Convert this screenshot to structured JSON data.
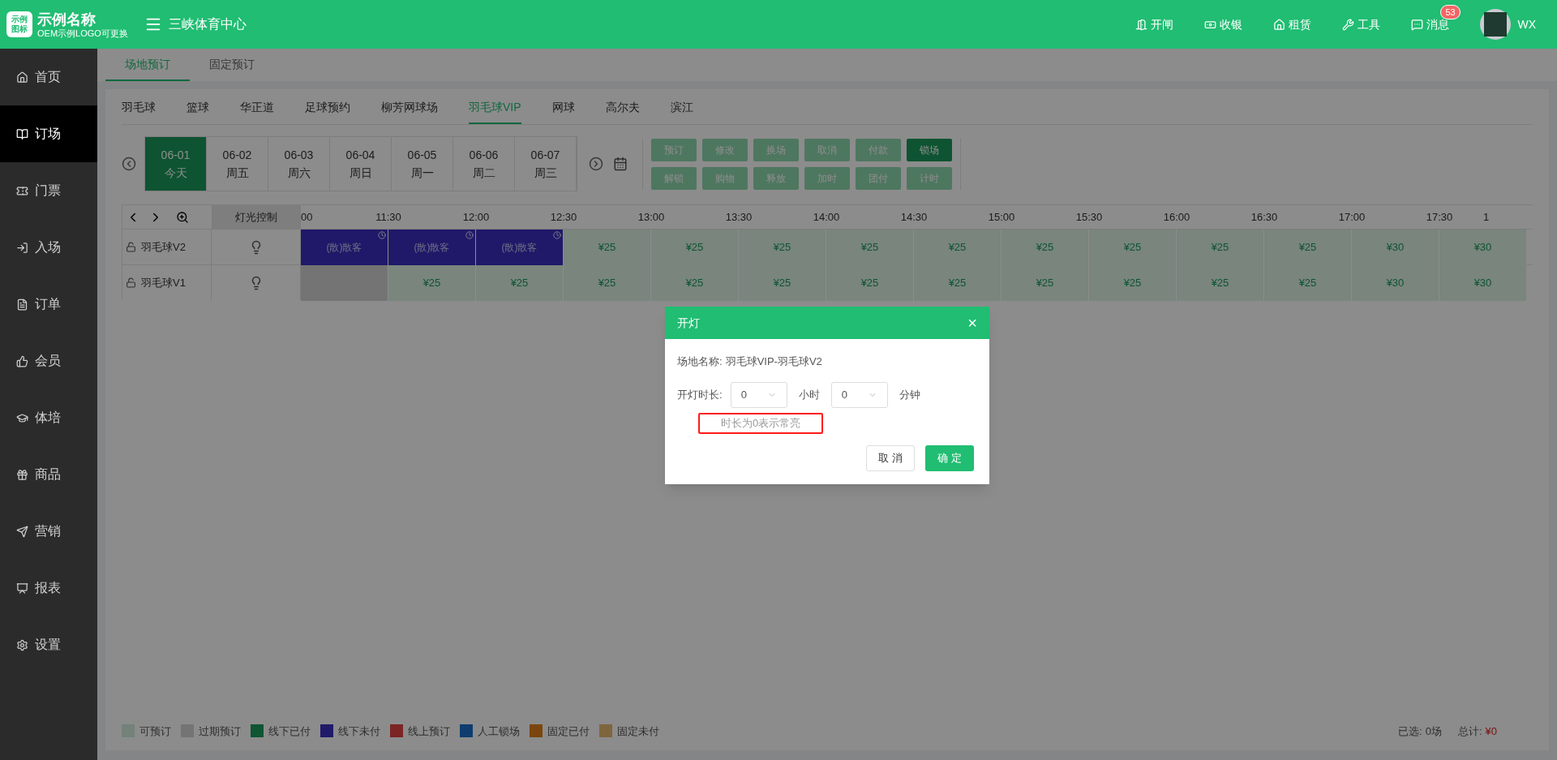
{
  "header": {
    "logo_mark": [
      "示例",
      "图标"
    ],
    "brand": "示例名称",
    "brand_sub": "OEM示例LOGO可更换",
    "venue": "三峡体育中心",
    "actions": [
      {
        "label": "开闸",
        "kind": "gate"
      },
      {
        "label": "收银",
        "kind": "cashier"
      },
      {
        "label": "租赁",
        "kind": "rent"
      },
      {
        "label": "工具",
        "kind": "tools"
      },
      {
        "label": "消息",
        "kind": "message",
        "badge": "53"
      }
    ],
    "user": "WX"
  },
  "sidebar": {
    "items": [
      {
        "label": "首页",
        "kind": "home",
        "selected": false
      },
      {
        "label": "订场",
        "kind": "booking",
        "selected": true
      },
      {
        "label": "门票",
        "kind": "ticket",
        "selected": false
      },
      {
        "label": "入场",
        "kind": "entry",
        "selected": false
      },
      {
        "label": "订单",
        "kind": "order",
        "selected": false
      },
      {
        "label": "会员",
        "kind": "member",
        "selected": false
      },
      {
        "label": "体培",
        "kind": "training",
        "selected": false
      },
      {
        "label": "商品",
        "kind": "goods",
        "selected": false
      },
      {
        "label": "营销",
        "kind": "marketing",
        "selected": false
      },
      {
        "label": "报表",
        "kind": "report",
        "selected": false
      },
      {
        "label": "设置",
        "kind": "settings",
        "selected": false
      }
    ]
  },
  "page_tabs": [
    {
      "label": "场地预订",
      "selected": true
    },
    {
      "label": "固定预订",
      "selected": false
    }
  ],
  "venue_tabs": [
    {
      "label": "羽毛球",
      "selected": false
    },
    {
      "label": "篮球",
      "selected": false
    },
    {
      "label": "华正道",
      "selected": false
    },
    {
      "label": "足球预约",
      "selected": false
    },
    {
      "label": "柳芳网球场",
      "selected": false
    },
    {
      "label": "羽毛球VIP",
      "selected": true
    },
    {
      "label": "网球",
      "selected": false
    },
    {
      "label": "高尔夫",
      "selected": false
    },
    {
      "label": "滨江",
      "selected": false
    }
  ],
  "dates": [
    {
      "date": "06-01",
      "day": "今天",
      "selected": true
    },
    {
      "date": "06-02",
      "day": "周五",
      "selected": false
    },
    {
      "date": "06-03",
      "day": "周六",
      "selected": false
    },
    {
      "date": "06-04",
      "day": "周日",
      "selected": false
    },
    {
      "date": "06-05",
      "day": "周一",
      "selected": false
    },
    {
      "date": "06-06",
      "day": "周二",
      "selected": false
    },
    {
      "date": "06-07",
      "day": "周三",
      "selected": false
    }
  ],
  "action_buttons": [
    {
      "label": "预订",
      "disabled": true
    },
    {
      "label": "修改",
      "disabled": true
    },
    {
      "label": "换场",
      "disabled": true
    },
    {
      "label": "取消",
      "disabled": true
    },
    {
      "label": "付款",
      "disabled": true
    },
    {
      "label": "锁场",
      "disabled": false
    },
    {
      "label": "解锁",
      "disabled": true
    },
    {
      "label": "购物",
      "disabled": true
    },
    {
      "label": "释放",
      "disabled": true
    },
    {
      "label": "加时",
      "disabled": true
    },
    {
      "label": "团付",
      "disabled": true
    },
    {
      "label": "计时",
      "disabled": true
    }
  ],
  "schedule": {
    "light_column": "灯光控制",
    "times": [
      "00",
      "11:30",
      "12:00",
      "12:30",
      "13:00",
      "13:30",
      "14:00",
      "14:30",
      "15:00",
      "15:30",
      "16:00",
      "16:30",
      "17:00",
      "17:30",
      "1"
    ],
    "rows": [
      {
        "name": "羽毛球V2",
        "cells": [
          {
            "kind": "booked",
            "text": "(散)散客"
          },
          {
            "kind": "booked",
            "text": "(散)散客"
          },
          {
            "kind": "booked",
            "text": "(散)散客"
          },
          {
            "kind": "available",
            "text": "¥25"
          },
          {
            "kind": "available",
            "text": "¥25"
          },
          {
            "kind": "available",
            "text": "¥25"
          },
          {
            "kind": "available",
            "text": "¥25"
          },
          {
            "kind": "available",
            "text": "¥25"
          },
          {
            "kind": "available",
            "text": "¥25"
          },
          {
            "kind": "available",
            "text": "¥25"
          },
          {
            "kind": "available",
            "text": "¥25"
          },
          {
            "kind": "available",
            "text": "¥25"
          },
          {
            "kind": "available",
            "text": "¥30"
          },
          {
            "kind": "available",
            "text": "¥30"
          }
        ]
      },
      {
        "name": "羽毛球V1",
        "cells": [
          {
            "kind": "expired"
          },
          {
            "kind": "available",
            "text": "¥25"
          },
          {
            "kind": "available",
            "text": "¥25"
          },
          {
            "kind": "available",
            "text": "¥25"
          },
          {
            "kind": "available",
            "text": "¥25"
          },
          {
            "kind": "available",
            "text": "¥25"
          },
          {
            "kind": "available",
            "text": "¥25"
          },
          {
            "kind": "available",
            "text": "¥25"
          },
          {
            "kind": "available",
            "text": "¥25"
          },
          {
            "kind": "available",
            "text": "¥25"
          },
          {
            "kind": "available",
            "text": "¥25"
          },
          {
            "kind": "available",
            "text": "¥25"
          },
          {
            "kind": "available",
            "text": "¥30"
          },
          {
            "kind": "available",
            "text": "¥30"
          }
        ]
      }
    ]
  },
  "legend": [
    {
      "label": "可预订",
      "color": "#748279"
    },
    {
      "label": "过期预订",
      "color": "#747474"
    },
    {
      "label": "线下已付",
      "color": "#0f5532"
    },
    {
      "label": "线下未付",
      "color": "#201a69"
    },
    {
      "label": "线上预订",
      "color": "#7b2525"
    },
    {
      "label": "人工锁场",
      "color": "#0e3d6e"
    },
    {
      "label": "固定已付",
      "color": "#7b460e"
    },
    {
      "label": "固定未付",
      "color": "#7f653d"
    }
  ],
  "summary": {
    "selected_label": "已选:",
    "selected_value": "0场",
    "total_label": "总计:",
    "total_value": "¥0"
  },
  "dialog": {
    "title": "开灯",
    "close": "×",
    "venue_label": "场地名称:",
    "venue_value": "羽毛球VIP-羽毛球V2",
    "duration_label": "开灯时长:",
    "hours_value": "0",
    "hours_unit": "小时",
    "minutes_value": "0",
    "minutes_unit": "分钟",
    "hint": "时长为0表示常亮",
    "hint_highlighted": true,
    "buttons": [
      {
        "label": "取 消",
        "kind": "cancel"
      },
      {
        "label": "确 定",
        "kind": "confirm"
      }
    ]
  }
}
